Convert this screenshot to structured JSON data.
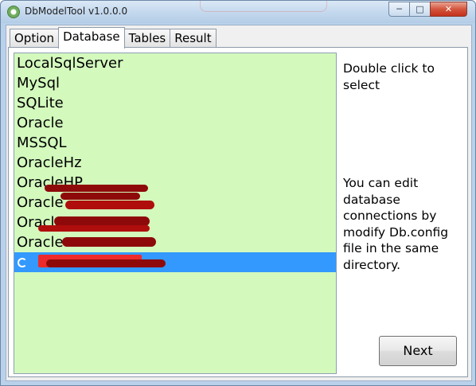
{
  "window": {
    "title": "DbModelTool v1.0.0.0",
    "controls": {
      "minimize": "─",
      "maximize": "□",
      "close": "✕"
    }
  },
  "tabs": [
    {
      "label": "Option"
    },
    {
      "label": "Database",
      "active": true
    },
    {
      "label": "Tables"
    },
    {
      "label": "Result"
    }
  ],
  "database_list": {
    "items": [
      {
        "label": "LocalSqlServer"
      },
      {
        "label": "MySql"
      },
      {
        "label": "SQLite"
      },
      {
        "label": "Oracle"
      },
      {
        "label": "MSSQL"
      },
      {
        "label": "OracleHz"
      },
      {
        "label": "OracleHP"
      },
      {
        "label": "Oracle"
      },
      {
        "label": "Oracle"
      },
      {
        "label": "Oracle"
      },
      {
        "label": "",
        "selected": true
      }
    ],
    "colors": {
      "background": "#d3f9bd",
      "selected": "#3399ff",
      "redaction": "#8e0a0a"
    }
  },
  "hints": {
    "top": "Double click to select",
    "bottom": "You can edit database connections by modify Db.config file in the same directory."
  },
  "buttons": {
    "next": "Next"
  }
}
